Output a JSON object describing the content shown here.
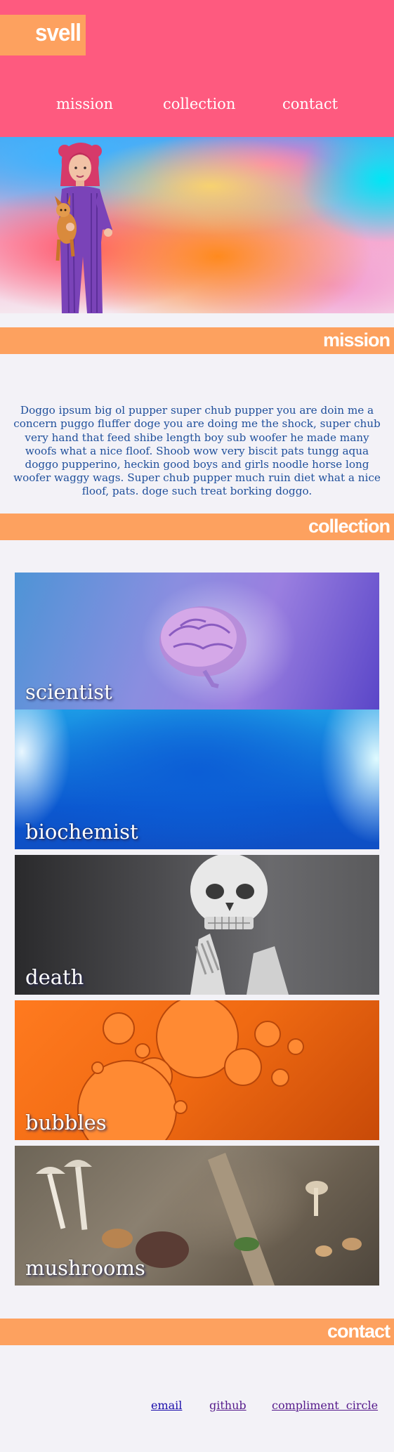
{
  "header": {
    "logo": "svell",
    "nav": [
      "mission",
      "collection",
      "contact"
    ]
  },
  "sections": {
    "mission": "mission",
    "collection": "collection",
    "contact": "contact"
  },
  "mission_text": "Doggo ipsum big ol pupper super chub pupper you are doin me a concern puggo fluffer doge you are doing me the shock, super chub very hand that feed shibe length boy sub woofer he made many woofs what a nice floof. Shoob wow very biscit pats tungg aqua doggo pupperino, heckin good boys and girls noodle horse long woofer waggy wags. Super chub pupper much ruin diet what a nice floof, pats. doge such treat borking doggo.",
  "collection": [
    {
      "label": "scientist"
    },
    {
      "label": "biochemist"
    },
    {
      "label": "death"
    },
    {
      "label": "bubbles"
    },
    {
      "label": "mushrooms"
    }
  ],
  "contact_links": {
    "email": "email",
    "github": "github",
    "compliment_circle": "compliment  circle"
  },
  "colors": {
    "header_bg": "#fe5a7f",
    "accent": "#fda15f",
    "page_bg": "#f3f2f7",
    "text_blue": "#1f4f9b",
    "link_blue": "#1a0dab",
    "link_visited": "#551a8b"
  }
}
